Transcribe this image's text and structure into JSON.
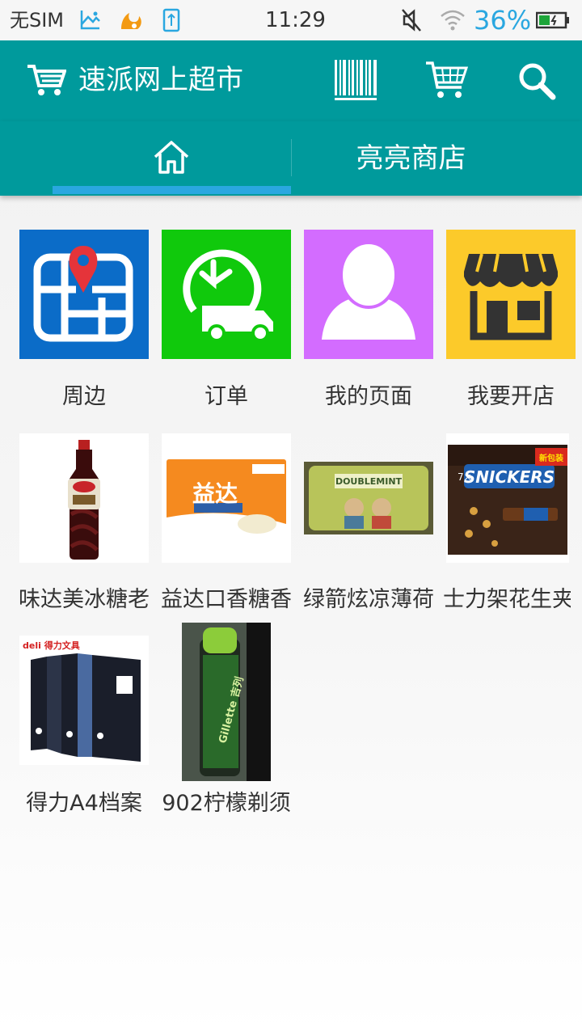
{
  "status_bar": {
    "carrier": "无SIM",
    "time": "11:29",
    "battery": "36%"
  },
  "app_bar": {
    "title": "速派网上超市"
  },
  "tabs": {
    "shop_label": "亮亮商店"
  },
  "shortcuts": [
    {
      "label": "周边",
      "color": "#0b6cc8"
    },
    {
      "label": "订单",
      "color": "#10c90c"
    },
    {
      "label": "我的页面",
      "color": "#d36cff"
    },
    {
      "label": "我要开店",
      "color": "#fcca2a"
    }
  ],
  "products": [
    {
      "label": "味达美冰糖老"
    },
    {
      "label": "益达口香糖香"
    },
    {
      "label": "绿箭炫凉薄荷"
    },
    {
      "label": "士力架花生夹"
    },
    {
      "label": "得力A4档案"
    },
    {
      "label": "902柠檬剃须"
    }
  ],
  "product_art_text": {
    "snickers": "SNICKERS",
    "snickers_count": "7×",
    "snickers_badge": "新包装",
    "yida": "益达",
    "doublemint": "DOUBLEMINT",
    "deli": "deli 得力文具",
    "gillette": "Gillette 吉列"
  }
}
